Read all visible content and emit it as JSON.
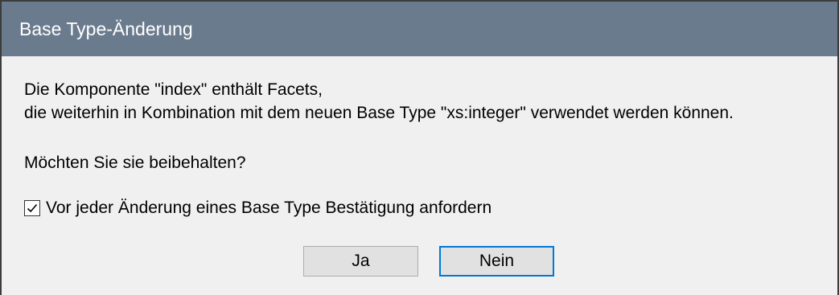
{
  "dialog": {
    "title": "Base Type-Änderung",
    "message_line1": "Die Komponente \"index\" enthält Facets,",
    "message_line2": "die weiterhin in Kombination mit dem neuen Base Type \"xs:integer\" verwendet werden können.",
    "question": "Möchten Sie sie beibehalten?",
    "checkbox": {
      "label": "Vor jeder Änderung eines Base Type Bestätigung anfordern",
      "checked": true
    },
    "buttons": {
      "yes_label": "Ja",
      "no_label": "Nein"
    }
  },
  "colors": {
    "titlebar": "#6b7b8e",
    "dialog_bg": "#f0f0f0",
    "button_bg": "#e1e1e1",
    "focus_border": "#0078d7"
  }
}
